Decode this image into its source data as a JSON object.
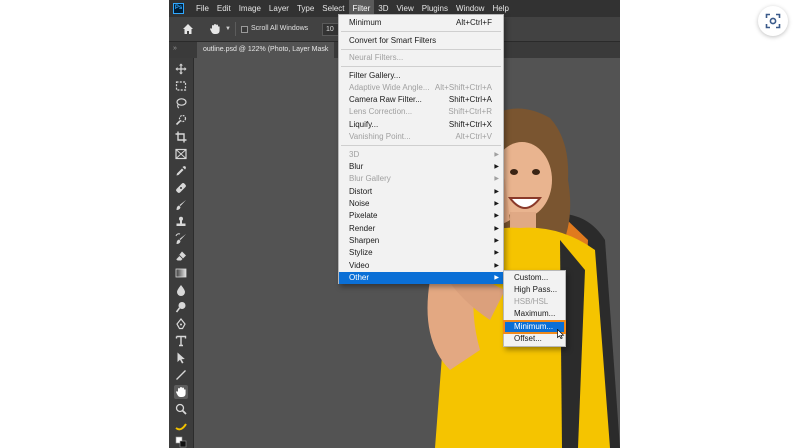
{
  "app": {
    "logo_text": "Ps",
    "menu": [
      "File",
      "Edit",
      "Image",
      "Layer",
      "Type",
      "Select",
      "Filter",
      "3D",
      "View",
      "Plugins",
      "Window",
      "Help"
    ],
    "active_menu": "Filter"
  },
  "options_bar": {
    "scroll_all_windows": "Scroll All Windows",
    "zoom_value": "10"
  },
  "document_tab": {
    "title": "outline.psd @ 122% (Photo, Layer Mask"
  },
  "filter_menu": {
    "items": [
      {
        "label": "Minimum",
        "shortcut": "Alt+Ctrl+F",
        "disabled": false
      },
      {
        "label": "Convert for Smart Filters",
        "shortcut": "",
        "disabled": false
      },
      {
        "label": "Neural Filters...",
        "shortcut": "",
        "disabled": true
      },
      {
        "label": "Filter Gallery...",
        "shortcut": "",
        "disabled": false
      },
      {
        "label": "Adaptive Wide Angle...",
        "shortcut": "Alt+Shift+Ctrl+A",
        "disabled": true
      },
      {
        "label": "Camera Raw Filter...",
        "shortcut": "Shift+Ctrl+A",
        "disabled": false
      },
      {
        "label": "Lens Correction...",
        "shortcut": "Shift+Ctrl+R",
        "disabled": true
      },
      {
        "label": "Liquify...",
        "shortcut": "Shift+Ctrl+X",
        "disabled": false
      },
      {
        "label": "Vanishing Point...",
        "shortcut": "Alt+Ctrl+V",
        "disabled": true
      },
      {
        "label": "3D",
        "submenu": true,
        "disabled": true
      },
      {
        "label": "Blur",
        "submenu": true,
        "disabled": false
      },
      {
        "label": "Blur Gallery",
        "submenu": true,
        "disabled": true
      },
      {
        "label": "Distort",
        "submenu": true,
        "disabled": false
      },
      {
        "label": "Noise",
        "submenu": true,
        "disabled": false
      },
      {
        "label": "Pixelate",
        "submenu": true,
        "disabled": false
      },
      {
        "label": "Render",
        "submenu": true,
        "disabled": false
      },
      {
        "label": "Sharpen",
        "submenu": true,
        "disabled": false
      },
      {
        "label": "Stylize",
        "submenu": true,
        "disabled": false
      },
      {
        "label": "Video",
        "submenu": true,
        "disabled": false
      },
      {
        "label": "Other",
        "submenu": true,
        "disabled": false,
        "highlighted": true
      }
    ]
  },
  "other_submenu": {
    "items": [
      {
        "label": "Custom...",
        "disabled": false
      },
      {
        "label": "High Pass...",
        "disabled": false
      },
      {
        "label": "HSB/HSL",
        "disabled": true
      },
      {
        "label": "Maximum...",
        "disabled": false
      },
      {
        "label": "Minimum...",
        "disabled": false,
        "highlighted": true
      },
      {
        "label": "Offset...",
        "disabled": false
      }
    ]
  },
  "colors": {
    "highlight": "#0a6fd6",
    "highlight_outline": "#f08a1c",
    "workspace": "#535353",
    "shirt": "#f5c400"
  },
  "toolbar_icons": [
    "move-icon",
    "marquee-icon",
    "lasso-icon",
    "quick-select-icon",
    "crop-icon",
    "frame-icon",
    "eyedropper-icon",
    "healing-brush-icon",
    "brush-icon",
    "stamp-icon",
    "history-brush-icon",
    "eraser-icon",
    "gradient-icon",
    "blur-icon",
    "dodge-icon",
    "pen-icon",
    "type-icon",
    "path-select-icon",
    "line-icon",
    "hand-icon",
    "zoom-icon",
    "edit-toolbar-icon",
    "color-swatches-icon"
  ]
}
